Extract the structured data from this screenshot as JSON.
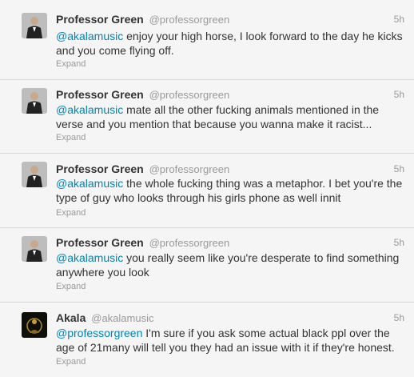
{
  "tweets": [
    {
      "fullname": "Professor Green",
      "username": "@professorgreen",
      "time": "5h",
      "mention": "@akalamusic",
      "text": " enjoy your high horse, I look forward to the day he kicks and you come flying off.",
      "expand": "Expand"
    },
    {
      "fullname": "Professor Green",
      "username": "@professorgreen",
      "time": "5h",
      "mention": "@akalamusic",
      "text": " mate all the other fucking animals mentioned in the verse and you mention that because you wanna make it racist...",
      "expand": "Expand"
    },
    {
      "fullname": "Professor Green",
      "username": "@professorgreen",
      "time": "5h",
      "mention": "@akalamusic",
      "text": " the whole fucking thing was a metaphor. I bet you're the type of guy who looks through his girls phone as well innit",
      "expand": "Expand"
    },
    {
      "fullname": "Professor Green",
      "username": "@professorgreen",
      "time": "5h",
      "mention": "@akalamusic",
      "text": " you really seem like you're desperate to find something anywhere you look",
      "expand": "Expand"
    },
    {
      "fullname": "Akala",
      "username": "@akalamusic",
      "time": "5h",
      "mention": "@professorgreen",
      "text": " I'm sure if you ask some actual black ppl over the age of 21many will tell you they had an issue with it if they're honest.",
      "expand": "Expand"
    }
  ]
}
